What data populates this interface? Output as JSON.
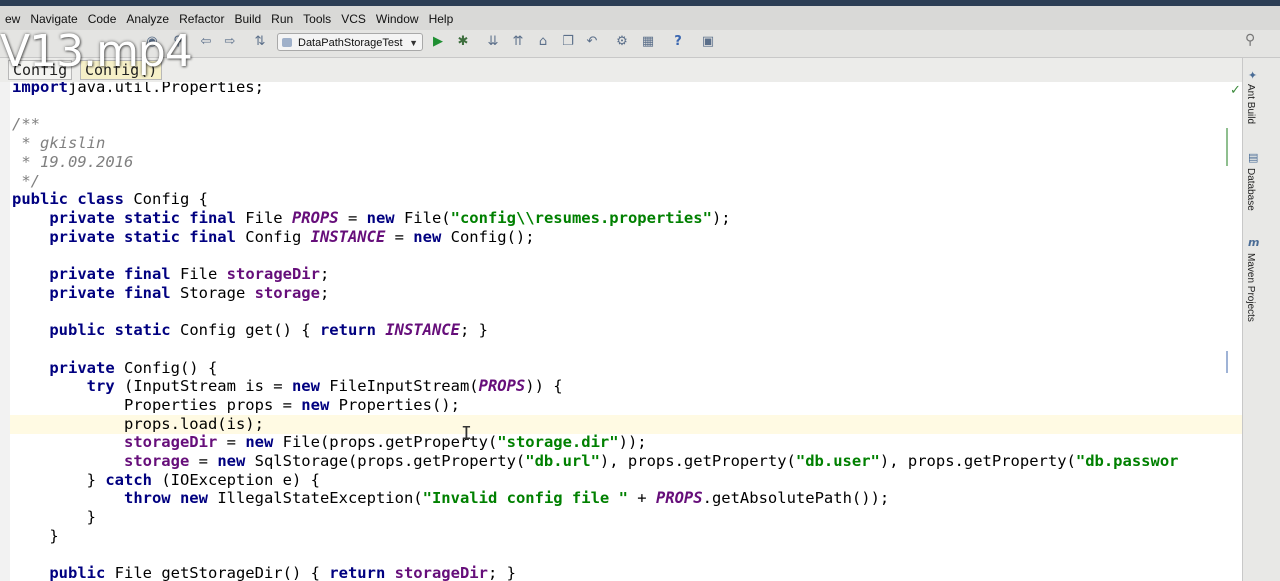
{
  "watermark": "V13.mp4",
  "menu": [
    "ew",
    "Navigate",
    "Code",
    "Analyze",
    "Refactor",
    "Build",
    "Run",
    "Tools",
    "VCS",
    "Window",
    "Help"
  ],
  "menu_mnemonic": [
    "",
    "N",
    "C",
    "z",
    "R",
    "B",
    "u",
    "T",
    "S",
    "W",
    "H"
  ],
  "toolbar": {
    "run_config_label": "DataPathStorageTest"
  },
  "breadcrumbs": [
    "Config",
    "Config()"
  ],
  "right_panel": {
    "tabs": [
      "Ant Build",
      "Database",
      "Maven Projects"
    ]
  },
  "code_lines": [
    [
      [
        "kw",
        "import"
      ],
      [
        "",
        "java.util.Properties;"
      ]
    ],
    [],
    [
      [
        "cm",
        "/**"
      ]
    ],
    [
      [
        "cm",
        " * gkislin"
      ]
    ],
    [
      [
        "cm",
        " * 19.09.2016"
      ]
    ],
    [
      [
        "cm",
        " */"
      ]
    ],
    [
      [
        "kw",
        "public class "
      ],
      [
        "",
        "Config {"
      ]
    ],
    [
      [
        "",
        "    "
      ],
      [
        "kw",
        "private static final "
      ],
      [
        "",
        "File "
      ],
      [
        "cs",
        "PROPS"
      ],
      [
        "",
        " = "
      ],
      [
        "kw",
        "new "
      ],
      [
        "",
        "File("
      ],
      [
        "st",
        "\"config\\\\resumes.properties\""
      ],
      [
        "",
        ");"
      ]
    ],
    [
      [
        "",
        "    "
      ],
      [
        "kw",
        "private static final "
      ],
      [
        "",
        "Config "
      ],
      [
        "cs",
        "INSTANCE"
      ],
      [
        "",
        " = "
      ],
      [
        "kw",
        "new "
      ],
      [
        "",
        "Config();"
      ]
    ],
    [],
    [
      [
        "",
        "    "
      ],
      [
        "kw",
        "private final "
      ],
      [
        "",
        "File "
      ],
      [
        "fd",
        "storageDir"
      ],
      [
        "",
        ";"
      ]
    ],
    [
      [
        "",
        "    "
      ],
      [
        "kw",
        "private final "
      ],
      [
        "",
        "Storage "
      ],
      [
        "fd",
        "storage"
      ],
      [
        "",
        ";"
      ]
    ],
    [],
    [
      [
        "",
        "    "
      ],
      [
        "kw",
        "public static "
      ],
      [
        "",
        "Config get() { "
      ],
      [
        "kw",
        "return "
      ],
      [
        "cs",
        "INSTANCE"
      ],
      [
        "",
        "; }"
      ]
    ],
    [],
    [
      [
        "",
        "    "
      ],
      [
        "kw",
        "private "
      ],
      [
        "",
        "Config() {"
      ]
    ],
    [
      [
        "",
        "        "
      ],
      [
        "kw",
        "try "
      ],
      [
        "",
        "(InputStream is = "
      ],
      [
        "kw",
        "new "
      ],
      [
        "",
        "FileInputStream("
      ],
      [
        "cs",
        "PROPS"
      ],
      [
        "",
        ")) {"
      ]
    ],
    [
      [
        "",
        "            Properties props = "
      ],
      [
        "kw",
        "new "
      ],
      [
        "",
        "Properties();"
      ]
    ],
    [
      [
        "",
        "            props.load(is);"
      ]
    ],
    [
      [
        "",
        "            "
      ],
      [
        "fd",
        "storageDir"
      ],
      [
        "",
        " = "
      ],
      [
        "kw",
        "new "
      ],
      [
        "",
        "File(props.getProperty("
      ],
      [
        "st",
        "\"storage.dir\""
      ],
      [
        "",
        "));"
      ]
    ],
    [
      [
        "",
        "            "
      ],
      [
        "fd",
        "storage"
      ],
      [
        "",
        " = "
      ],
      [
        "kw",
        "new "
      ],
      [
        "",
        "SqlStorage(props.getProperty("
      ],
      [
        "st",
        "\"db.url\""
      ],
      [
        "",
        "), props.getProperty("
      ],
      [
        "st",
        "\"db.user\""
      ],
      [
        "",
        "), props.getProperty("
      ],
      [
        "st",
        "\"db.passwor"
      ]
    ],
    [
      [
        "",
        "        } "
      ],
      [
        "kw",
        "catch "
      ],
      [
        "",
        "(IOException e) {"
      ]
    ],
    [
      [
        "",
        "            "
      ],
      [
        "kw",
        "throw new "
      ],
      [
        "",
        "IllegalStateException("
      ],
      [
        "st",
        "\"Invalid config file \""
      ],
      [
        "",
        " + "
      ],
      [
        "cs",
        "PROPS"
      ],
      [
        "",
        ".getAbsolutePath());"
      ]
    ],
    [
      [
        "",
        "        }"
      ]
    ],
    [
      [
        "",
        "    }"
      ]
    ],
    [],
    [
      [
        "",
        "    "
      ],
      [
        "kw",
        "public "
      ],
      [
        "",
        "File getStorageDir() { "
      ],
      [
        "kw",
        "return "
      ],
      [
        "fd",
        "storageDir"
      ],
      [
        "",
        "; }"
      ]
    ]
  ],
  "colors": {
    "keyword": "#000080",
    "string": "#008000",
    "field": "#660e7a",
    "comment": "#808080",
    "current_line": "#fffae3"
  }
}
